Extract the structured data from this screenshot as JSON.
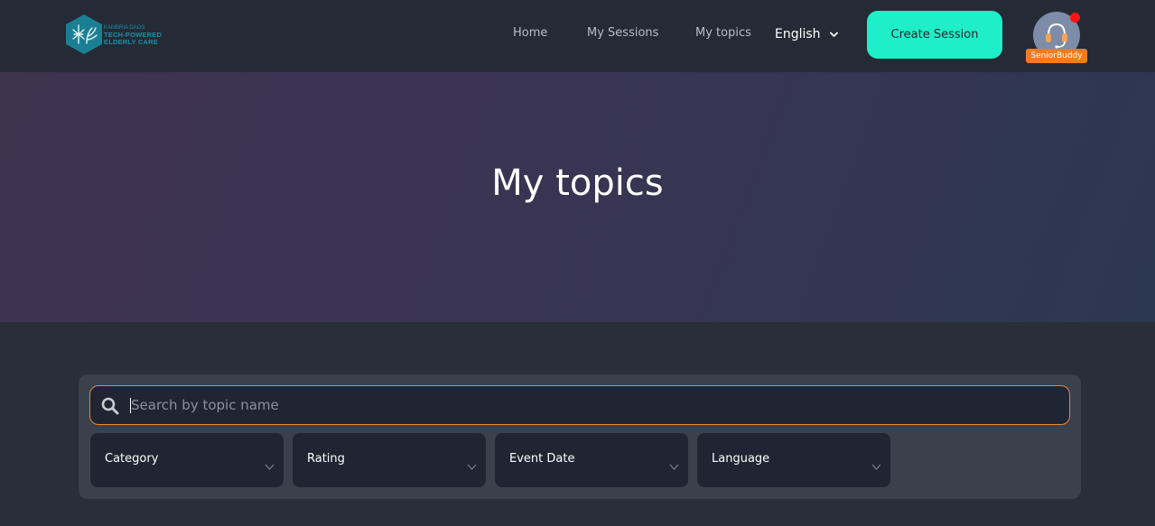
{
  "logo": {
    "line1": "KAMBRIA DAOS",
    "line2": "TECH-POWERED",
    "line3": "ELDERLY CARE",
    "color": "#1a8fa6"
  },
  "nav": {
    "links": [
      "Home",
      "My Sessions",
      "My topics"
    ],
    "language": "English",
    "create_button": "Create Session",
    "user_badge": "SeniorBuddy",
    "accent": "#1fefc8",
    "badge_color": "#f07c22",
    "notification_color": "#ff1414"
  },
  "hero": {
    "title": "My topics"
  },
  "filters": {
    "search_placeholder": "Search by topic name",
    "search_value": "",
    "dropdowns": [
      "Category",
      "Rating",
      "Event Date",
      "Language"
    ],
    "focus_border_color": "#e08a3c"
  },
  "icons": [
    "logo-hex-icon",
    "chevron-down-icon",
    "headset-icon",
    "search-icon"
  ]
}
